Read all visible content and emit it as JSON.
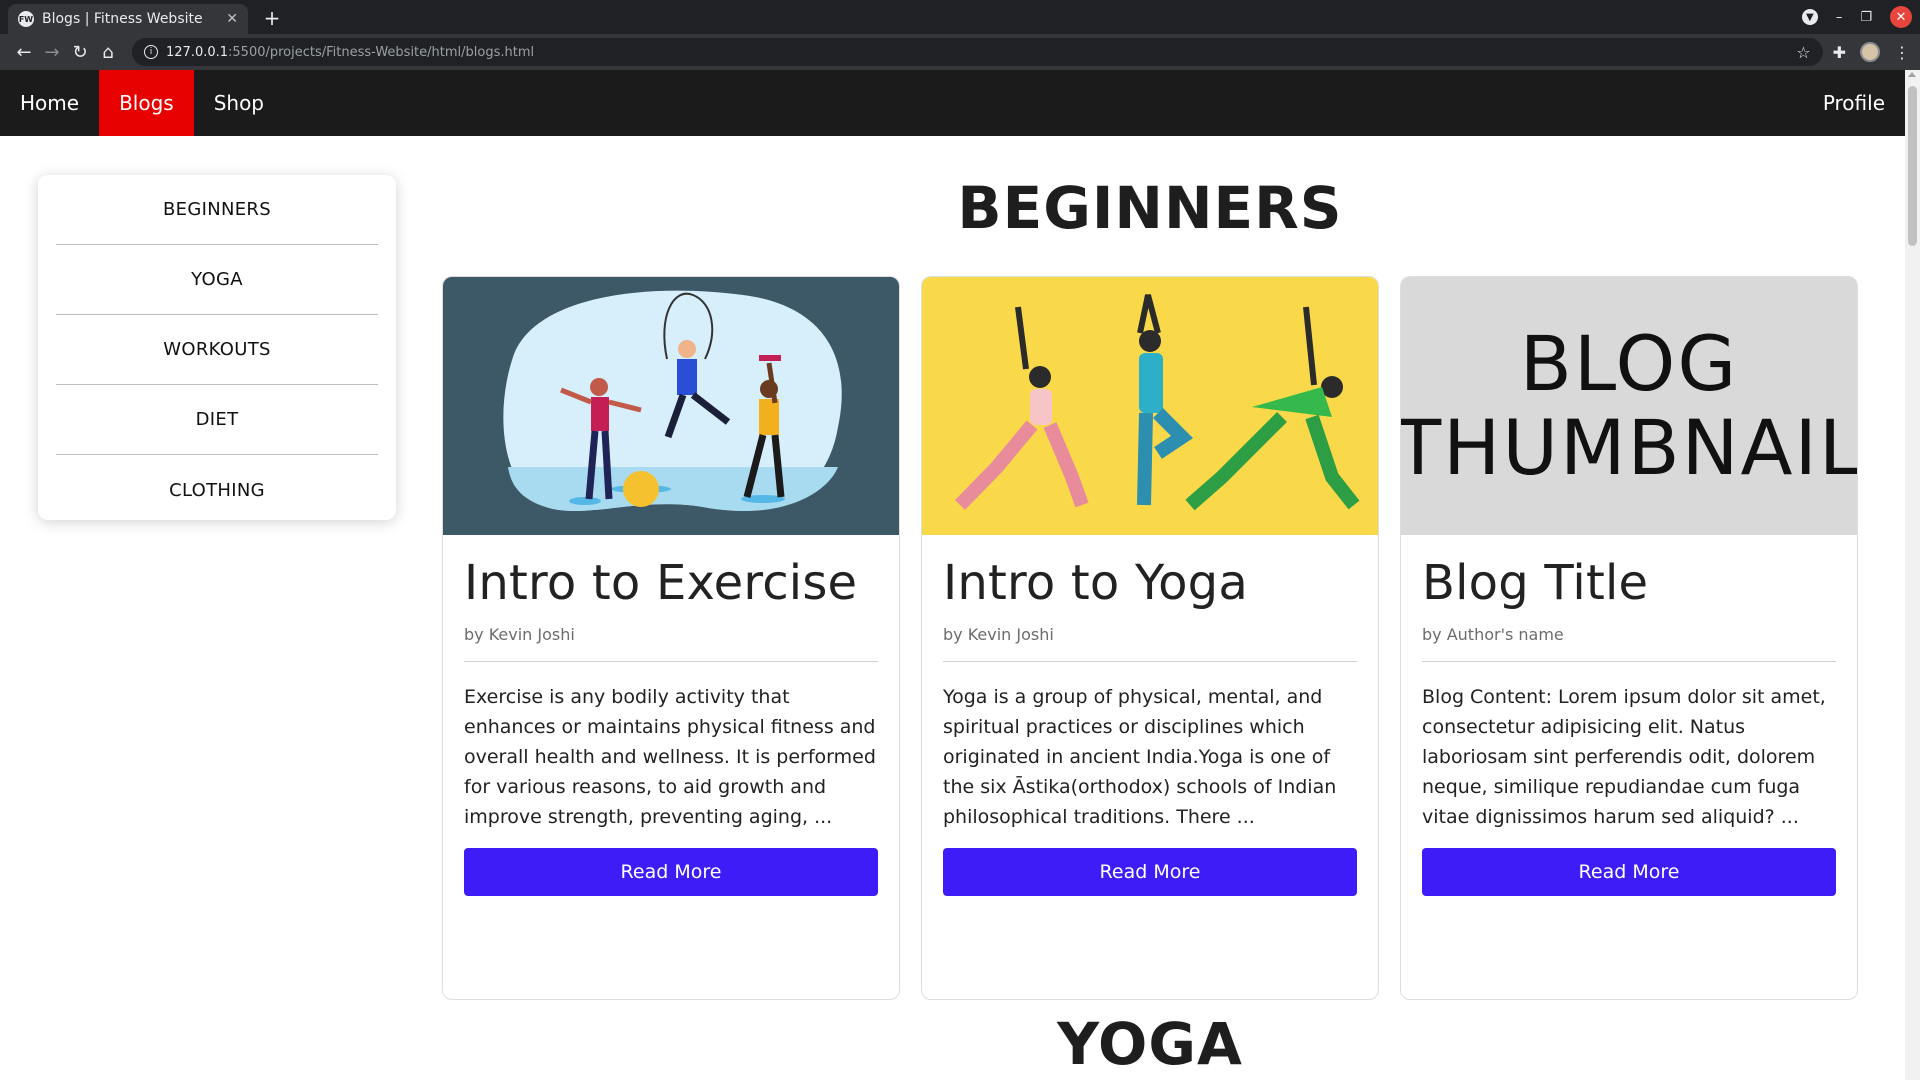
{
  "browser": {
    "tab_title": "Blogs | Fitness Website",
    "favicon_text": "FW",
    "url_host": "127.0.0.1",
    "url_path": ":5500/projects/Fitness-Website/html/blogs.html"
  },
  "nav": {
    "home": "Home",
    "blogs": "Blogs",
    "shop": "Shop",
    "profile": "Profile",
    "active_color": "#e60000"
  },
  "sidebar": {
    "items": [
      {
        "label": "BEGINNERS"
      },
      {
        "label": "YOGA"
      },
      {
        "label": "WORKOUTS"
      },
      {
        "label": "DIET"
      },
      {
        "label": "CLOTHING"
      }
    ]
  },
  "sections": {
    "beginners_title": "BEGINNERS",
    "yoga_title": "YOGA"
  },
  "cards": [
    {
      "title": "Intro to Exercise",
      "author": "by Kevin Joshi",
      "content": "Exercise is any bodily activity that enhances or maintains physical fitness and overall health and wellness. It is performed for various reasons, to aid growth and improve strength, preventing aging, ...",
      "button": "Read More"
    },
    {
      "title": "Intro to Yoga",
      "author": "by Kevin Joshi",
      "content": "Yoga is a group of physical, mental, and spiritual practices or disciplines which originated in ancient India.Yoga is one of the six Āstika(orthodox) schools of Indian philosophical traditions. There ...",
      "button": "Read More"
    },
    {
      "title": "Blog Title",
      "author": "by Author's name",
      "content": "Blog Content: Lorem ipsum dolor sit amet, consectetur adipisicing elit. Natus laboriosam sint perferendis odit, dolorem neque, similique repudiandae cum fuga vitae dignissimos harum sed aliquid? ...",
      "button": "Read More",
      "thumb_line1": "BLOG",
      "thumb_line2": "THUMBNAIL"
    }
  ],
  "colors": {
    "button": "#3e1cf7",
    "navbar": "#1b1b1b"
  }
}
